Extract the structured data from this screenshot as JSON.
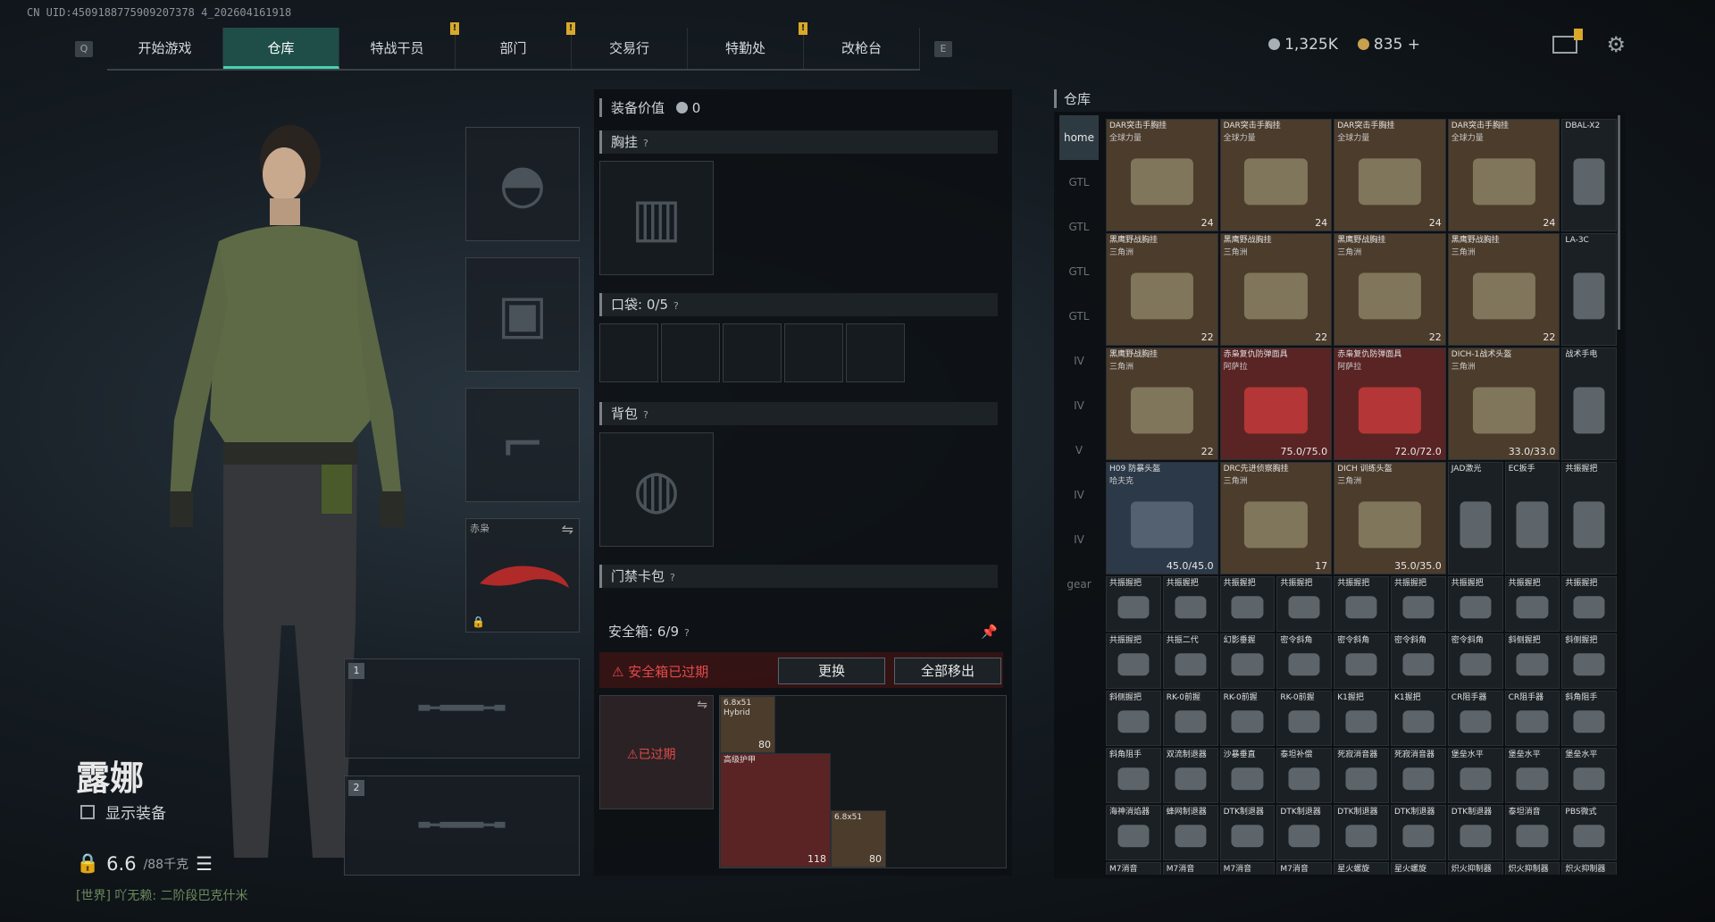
{
  "uid_text": "CN UID:4509188775909207378 4_202604161918",
  "nav": {
    "left_key": "Q",
    "right_key": "E",
    "tabs": [
      {
        "label": "开始游戏",
        "alert": false
      },
      {
        "label": "仓库",
        "alert": false,
        "active": true
      },
      {
        "label": "特战干员",
        "alert": true
      },
      {
        "label": "部门",
        "alert": true
      },
      {
        "label": "交易行",
        "alert": false
      },
      {
        "label": "特勤处",
        "alert": true
      },
      {
        "label": "改枪台",
        "alert": false
      }
    ],
    "alert_mark": "!"
  },
  "currency": {
    "silver": "1,325K",
    "gold": "835",
    "plus": "+"
  },
  "character": {
    "name": "露娜",
    "show_equipment_label": "显示装备",
    "weight": "6.6",
    "weight_max": "/88千克",
    "chat": "[世界] 吖无赖: 二阶段巴克什米"
  },
  "equip_slots": {
    "melee_label": "赤枭",
    "weapon1_num": "1",
    "weapon2_num": "2"
  },
  "center": {
    "value_label": "装备价值",
    "value": "0",
    "chest_rig_label": "胸挂",
    "pocket_label": "口袋:",
    "pocket_count": "0/5",
    "backpack_label": "背包",
    "card_bag_label": "门禁卡包",
    "safe_label": "安全箱:",
    "safe_count": "6/9",
    "safe_expired_text": "安全箱已过期",
    "replace_button": "更换",
    "remove_all_button": "全部移出",
    "expired_overlay": "已过期",
    "help_mark": "?",
    "safe_items": [
      {
        "name": "6.8x51 Hybrid",
        "qty": "80"
      },
      {
        "name": "高级护甲",
        "qty": "118"
      },
      {
        "name": "6.8x51",
        "qty": "80"
      }
    ]
  },
  "warehouse": {
    "title": "仓库",
    "side_tabs": [
      "home",
      "GTL",
      "GTL",
      "GTL",
      "GTL",
      "IV",
      "IV",
      "V",
      "IV",
      "IV",
      "gear"
    ],
    "rows": [
      [
        {
          "name": "DAR突击手胸挂",
          "sub": "全球力量",
          "qty": "24",
          "w": 2,
          "color": "tan"
        },
        {
          "name": "DAR突击手胸挂",
          "sub": "全球力量",
          "qty": "24",
          "w": 2,
          "color": "tan"
        },
        {
          "name": "DAR突击手胸挂",
          "sub": "全球力量",
          "qty": "24",
          "w": 2,
          "color": "tan"
        },
        {
          "name": "DAR突击手胸挂",
          "sub": "全球力量",
          "qty": "24",
          "w": 2,
          "color": "tan"
        },
        {
          "name": "DBAL-X2",
          "sub": "",
          "qty": "",
          "w": 1,
          "color": ""
        }
      ],
      [
        {
          "name": "黑鹰野战胸挂",
          "sub": "三角洲",
          "qty": "22",
          "w": 2,
          "color": "tan"
        },
        {
          "name": "黑鹰野战胸挂",
          "sub": "三角洲",
          "qty": "22",
          "w": 2,
          "color": "tan"
        },
        {
          "name": "黑鹰野战胸挂",
          "sub": "三角洲",
          "qty": "22",
          "w": 2,
          "color": "tan"
        },
        {
          "name": "黑鹰野战胸挂",
          "sub": "三角洲",
          "qty": "22",
          "w": 2,
          "color": "tan"
        },
        {
          "name": "LA-3C",
          "sub": "",
          "qty": "",
          "w": 1,
          "color": ""
        }
      ],
      [
        {
          "name": "黑鹰野战胸挂",
          "sub": "三角洲",
          "qty": "22",
          "w": 2,
          "color": "tan"
        },
        {
          "name": "赤枭复仇防弹面具",
          "sub": "阿萨拉",
          "qty": "75.0/75.0",
          "w": 2,
          "color": "red"
        },
        {
          "name": "赤枭复仇防弹面具",
          "sub": "阿萨拉",
          "qty": "72.0/72.0",
          "w": 2,
          "color": "red"
        },
        {
          "name": "DICH-1战术头盔",
          "sub": "三角洲",
          "qty": "33.0/33.0",
          "w": 2,
          "color": "tan"
        },
        {
          "name": "战术手电",
          "sub": "",
          "qty": "",
          "w": 1,
          "color": ""
        }
      ],
      [
        {
          "name": "H09 防暴头盔",
          "sub": "哈夫克",
          "qty": "45.0/45.0",
          "w": 2,
          "color": "blu"
        },
        {
          "name": "DRC先进侦察胸挂",
          "sub": "三角洲",
          "qty": "17",
          "w": 2,
          "color": "tan"
        },
        {
          "name": "DICH 训练头盔",
          "sub": "三角洲",
          "qty": "35.0/35.0",
          "w": 2,
          "color": "tan"
        },
        {
          "name": "JAD激光",
          "sub": "",
          "qty": "",
          "w": 1,
          "color": ""
        },
        {
          "name": "EC扳手",
          "sub": "",
          "qty": "",
          "w": 1,
          "color": ""
        },
        {
          "name": "共振握把",
          "sub": "",
          "qty": "",
          "w": 1,
          "color": ""
        }
      ],
      [
        {
          "name": "共振握把"
        },
        {
          "name": "共振握把"
        },
        {
          "name": "共振握把"
        },
        {
          "name": "共振握把"
        },
        {
          "name": "共振握把"
        },
        {
          "name": "共振握把"
        },
        {
          "name": "共振握把"
        },
        {
          "name": "共振握把"
        },
        {
          "name": "共振握把"
        }
      ],
      [
        {
          "name": "共振握把"
        },
        {
          "name": "共振二代"
        },
        {
          "name": "幻影垂握"
        },
        {
          "name": "密令斜角"
        },
        {
          "name": "密令斜角"
        },
        {
          "name": "密令斜角"
        },
        {
          "name": "密令斜角"
        },
        {
          "name": "斜侧握把"
        },
        {
          "name": "斜侧握把"
        }
      ],
      [
        {
          "name": "斜侧握把"
        },
        {
          "name": "RK-0前握"
        },
        {
          "name": "RK-0前握"
        },
        {
          "name": "RK-0前握"
        },
        {
          "name": "K1握把"
        },
        {
          "name": "K1握把"
        },
        {
          "name": "CR阻手器"
        },
        {
          "name": "CR阻手器"
        },
        {
          "name": "斜角阻手"
        }
      ],
      [
        {
          "name": "斜角阻手"
        },
        {
          "name": "双流制退器"
        },
        {
          "name": "沙暴垂直"
        },
        {
          "name": "泰坦补偿"
        },
        {
          "name": "死寂消音器"
        },
        {
          "name": "死寂消音器"
        },
        {
          "name": "堡垒水平"
        },
        {
          "name": "堡垒水平"
        },
        {
          "name": "堡垒水平"
        }
      ],
      [
        {
          "name": "海神消焰器"
        },
        {
          "name": "蜂网制退器"
        },
        {
          "name": "DTK制退器"
        },
        {
          "name": "DTK制退器"
        },
        {
          "name": "DTK制退器"
        },
        {
          "name": "DTK制退器"
        },
        {
          "name": "DTK制退器"
        },
        {
          "name": "泰坦消音"
        },
        {
          "name": "PBS微式"
        }
      ],
      [
        {
          "name": "M7消音"
        },
        {
          "name": "M7消音"
        },
        {
          "name": "M7消音"
        },
        {
          "name": "M7消音"
        },
        {
          "name": "星火螺旋"
        },
        {
          "name": "星火螺旋"
        },
        {
          "name": "炽火抑制器"
        },
        {
          "name": "炽火抑制器"
        },
        {
          "name": "炽火抑制器"
        }
      ]
    ]
  },
  "colors": {
    "accent": "#49d1b0",
    "alert": "#d9a82a",
    "danger": "#e24a4a",
    "gold": "#c8a050",
    "silver": "#a8b0b6"
  }
}
